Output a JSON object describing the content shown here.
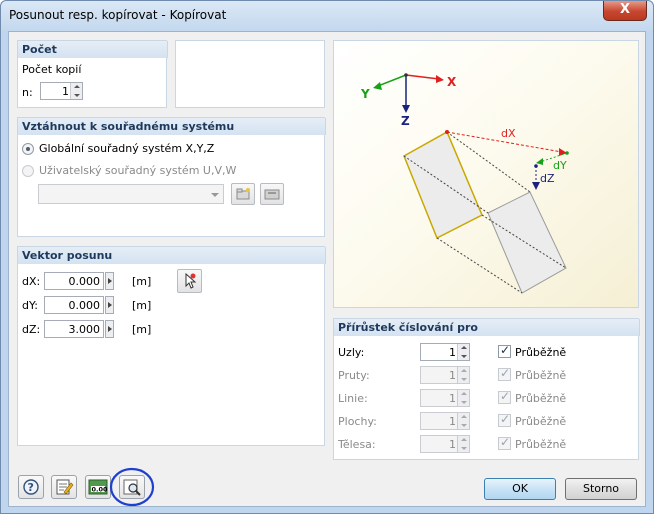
{
  "window": {
    "title": "Posunout resp. kopírovat - Kopírovat",
    "close_symbol": "X"
  },
  "count_group": {
    "header": "Počet",
    "copies_label": "Počet kopií",
    "n_label": "n:",
    "n_value": "1"
  },
  "coord_group": {
    "header": "Vztáhnout k souřadnému systému",
    "global_label": "Globální souřadný systém X,Y,Z",
    "user_label": "Uživatelský souřadný systém U,V,W",
    "selected": "global"
  },
  "vector_group": {
    "header": "Vektor posunu",
    "rows": [
      {
        "label": "dX:",
        "value": "0.000",
        "unit": "[m]"
      },
      {
        "label": "dY:",
        "value": "0.000",
        "unit": "[m]"
      },
      {
        "label": "dZ:",
        "value": "3.000",
        "unit": "[m]"
      }
    ]
  },
  "preview": {
    "axis_x": "X",
    "axis_y": "Y",
    "axis_z": "Z",
    "dx": "dX",
    "dy": "dY",
    "dz": "dZ"
  },
  "numbering_group": {
    "header": "Přírůstek číslování pro",
    "rows": [
      {
        "label": "Uzly:",
        "value": "1",
        "check_label": "Průběžně",
        "checked": true,
        "enabled": true
      },
      {
        "label": "Pruty:",
        "value": "1",
        "check_label": "Průběžně",
        "checked": true,
        "enabled": false
      },
      {
        "label": "Linie:",
        "value": "1",
        "check_label": "Průběžně",
        "checked": true,
        "enabled": false
      },
      {
        "label": "Plochy:",
        "value": "1",
        "check_label": "Průběžně",
        "checked": true,
        "enabled": false
      },
      {
        "label": "Tělesa:",
        "value": "1",
        "check_label": "Průběžně",
        "checked": true,
        "enabled": false
      }
    ]
  },
  "toolbar": {
    "help_icon": "help-icon",
    "edit_icon": "edit-icon",
    "units_icon": "units-icon",
    "units_text": "0.00",
    "view_icon": "view-icon"
  },
  "buttons": {
    "ok": "OK",
    "cancel": "Storno"
  },
  "colors": {
    "axis_x": "#e02020",
    "axis_y": "#18a018",
    "axis_z": "#1a237e",
    "highlight_circle": "#1f3fcf"
  }
}
